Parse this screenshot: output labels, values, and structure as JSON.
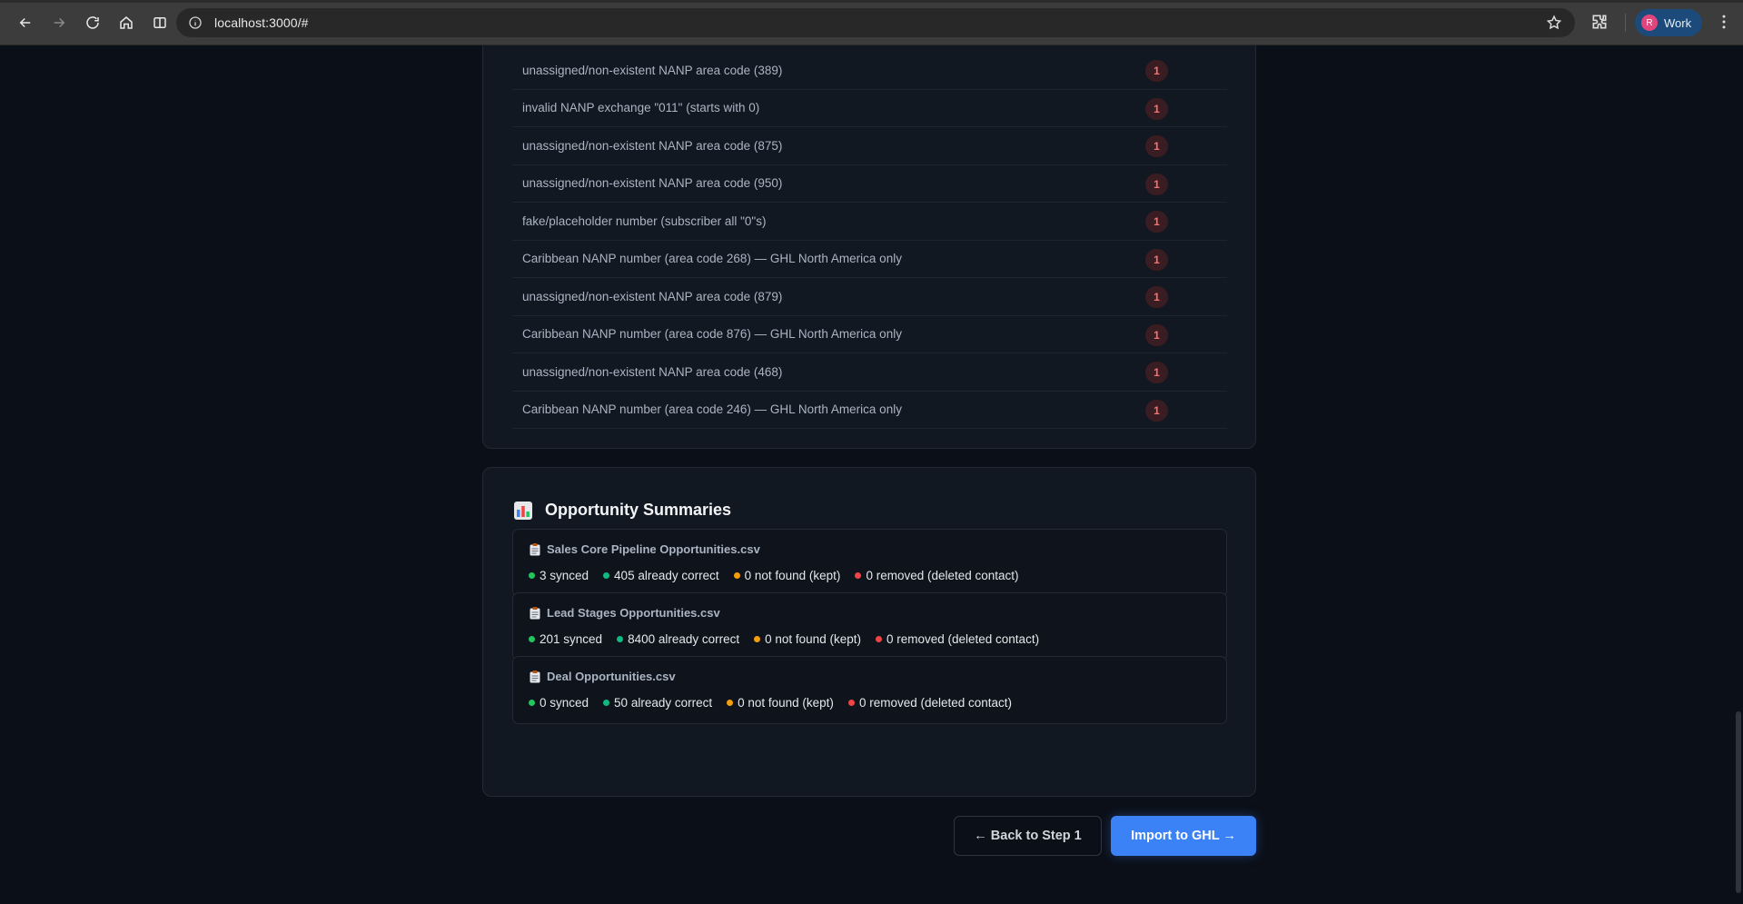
{
  "browser": {
    "url": "localhost:3000/#",
    "profile_name": "Work",
    "profile_initial": "R"
  },
  "issues": [
    {
      "reason": "unassigned/non-existent NANP area code (389)",
      "count": "1"
    },
    {
      "reason": "invalid NANP exchange \"011\" (starts with 0)",
      "count": "1"
    },
    {
      "reason": "unassigned/non-existent NANP area code (875)",
      "count": "1"
    },
    {
      "reason": "unassigned/non-existent NANP area code (950)",
      "count": "1"
    },
    {
      "reason": "fake/placeholder number (subscriber all \"0\"s)",
      "count": "1"
    },
    {
      "reason": "Caribbean NANP number (area code 268) — GHL North America only",
      "count": "1"
    },
    {
      "reason": "unassigned/non-existent NANP area code (879)",
      "count": "1"
    },
    {
      "reason": "Caribbean NANP number (area code 876) — GHL North America only",
      "count": "1"
    },
    {
      "reason": "unassigned/non-existent NANP area code (468)",
      "count": "1"
    },
    {
      "reason": "Caribbean NANP number (area code 246) — GHL North America only",
      "count": "1"
    }
  ],
  "opportunities": {
    "title": "Opportunity Summaries",
    "title_icon": "bar-chart-icon",
    "files": [
      {
        "name": "Sales Core Pipeline Opportunities.csv",
        "synced": "3 synced",
        "already_correct": "405 already correct",
        "not_found": "0 not found (kept)",
        "removed": "0 removed (deleted contact)"
      },
      {
        "name": "Lead Stages Opportunities.csv",
        "synced": "201 synced",
        "already_correct": "8400 already correct",
        "not_found": "0 not found (kept)",
        "removed": "0 removed (deleted contact)"
      },
      {
        "name": "Deal Opportunities.csv",
        "synced": "0 synced",
        "already_correct": "50 already correct",
        "not_found": "0 not found (kept)",
        "removed": "0 removed (deleted contact)"
      }
    ]
  },
  "actions": {
    "back_label": "← Back to Step 1",
    "import_label": "Import to GHL →"
  },
  "colors": {
    "green": "#22c55e",
    "teal": "#10b981",
    "amber": "#f59e0b",
    "red": "#ef4444",
    "primary": "#3b82f6",
    "badge_text": "#f87171"
  }
}
